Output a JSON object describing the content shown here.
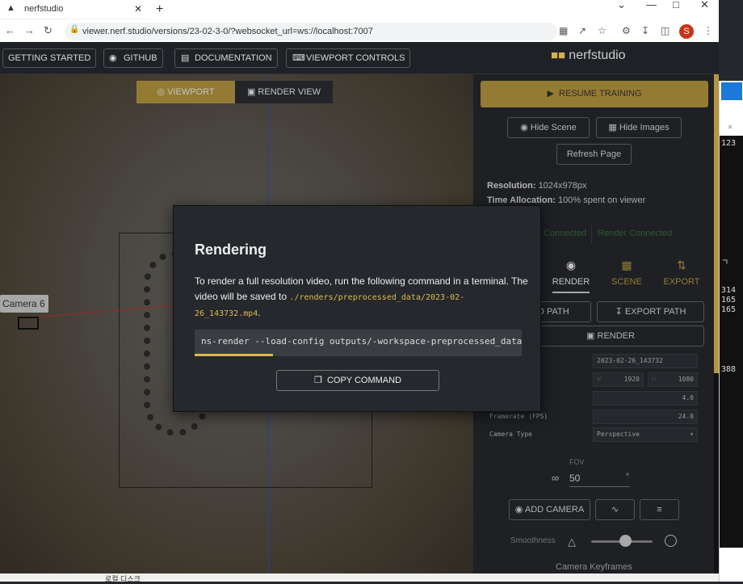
{
  "browser": {
    "tab_title": "nerfstudio",
    "url": "viewer.nerf.studio/versions/23-02-3-0/?websocket_url=ws://localhost:7007",
    "profile_initial": "S"
  },
  "appbar": {
    "getting_started": "GETTING STARTED",
    "github": "GITHUB",
    "documentation": "DOCUMENTATION",
    "viewport_controls": "VIEWPORT CONTROLS",
    "logo_text": "nerfstudio"
  },
  "viewport": {
    "viewport_tab": "VIEWPORT",
    "render_view_tab": "RENDER VIEW",
    "camera_label": "Camera 6"
  },
  "panel": {
    "resume_training": "RESUME TRAINING",
    "hide_scene": "Hide Scene",
    "hide_images": "Hide Images",
    "refresh_page": "Refresh Page",
    "resolution_label": "Resolution:",
    "resolution_value": "1024x978px",
    "time_label": "Time Allocation:",
    "time_value": "100% spent on viewer",
    "connected": "Connected",
    "render_connected": "Render Connected",
    "tabs": {
      "render": "RENDER",
      "scene": "SCENE",
      "export": "EXPORT"
    },
    "load_path": "D PATH",
    "export_path": "EXPORT PATH",
    "render_button": "RENDER",
    "output_name": "2023-02-26_143732",
    "width": "1920",
    "height": "1080",
    "width_prefix": "W",
    "height_prefix": "H",
    "duration": "4.0",
    "framerate_label": "Framerate (FPS)",
    "framerate": "24.0",
    "camera_type_label": "Camera Type",
    "camera_type": "Perspective",
    "fov_label": "FOV",
    "fov_value": "50",
    "fov_unit": "°",
    "add_camera": "ADD CAMERA",
    "smoothness": "Smoothness",
    "smoothness_value": 0.55,
    "camera_keyframes": "Camera Keyframes"
  },
  "modal": {
    "title": "Rendering",
    "text_1": "To render a full resolution video, run the following command in a terminal.",
    "text_2": "The video will be saved to",
    "save_path": "./renders/preprocessed_data/2023-02-26_143732.mp4",
    "text_3": ".",
    "command": "ns-render --load-config outputs/-workspace-preprocessed_data/nerfacto/2023-02-26_143007/config.yml --traj filename --camera-path-filename /workspace/preprocessed_data/camera_paths/2023-02-26_143732.json --output-path renders/preprocessed_data/2023-02-26_143732.mp4",
    "copy_command": "COPY COMMAND",
    "progress": 0.24
  },
  "side_window": {
    "numbers": [
      "123",
      "314",
      "165",
      "165",
      "388"
    ],
    "tail": "ㄱ"
  },
  "taskbar": {
    "item": "로컬 디스크"
  },
  "colors": {
    "accent": "#b5963f",
    "code": "#e0b84e",
    "panel_bg": "#25282c"
  }
}
